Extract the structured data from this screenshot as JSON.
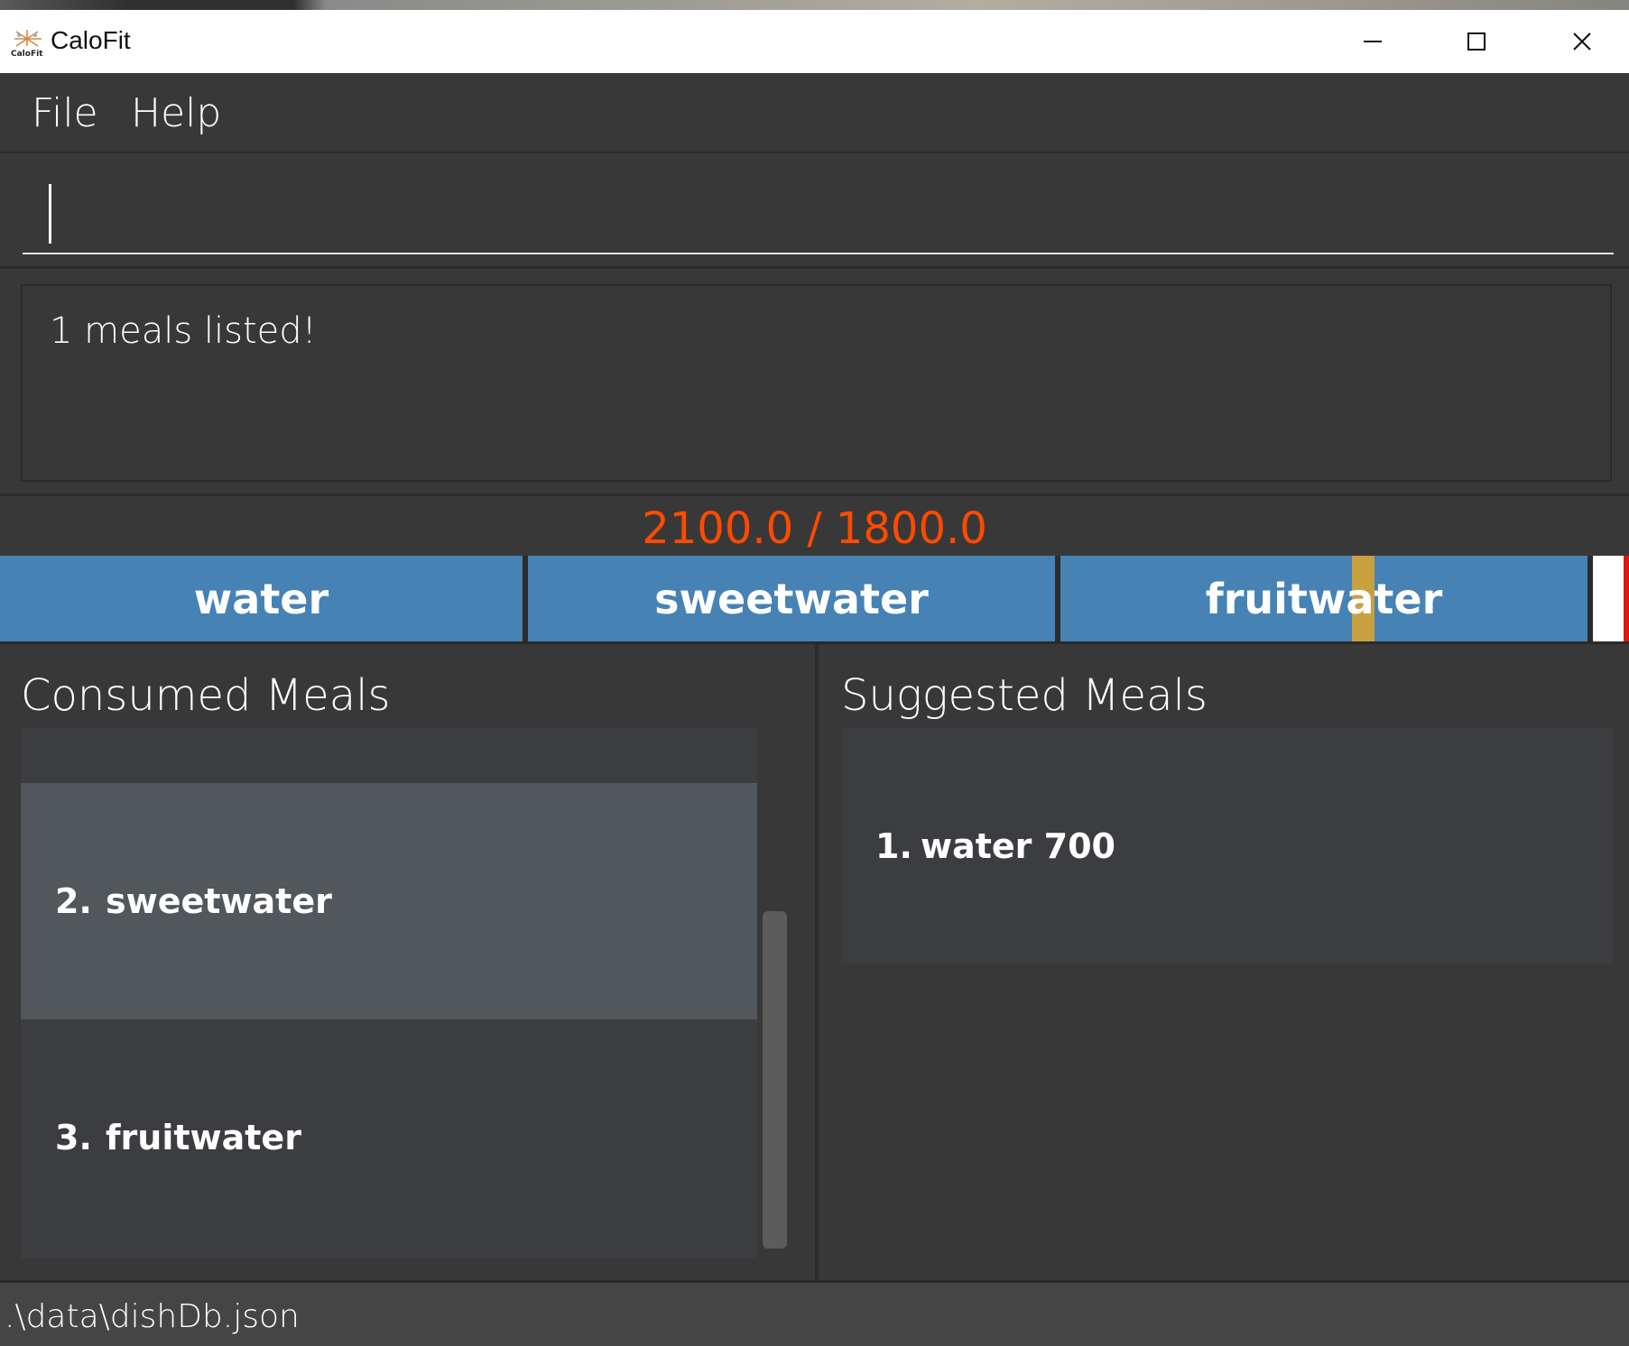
{
  "window": {
    "title": "CaloFit",
    "logo_text": "CaloFit"
  },
  "menu": {
    "items": [
      "File",
      "Help"
    ]
  },
  "command": {
    "value": ""
  },
  "result": {
    "message": "1 meals listed!"
  },
  "calories": {
    "text": "2100.0 / 1800.0",
    "color": "#ff4a00",
    "consumed": 2100.0,
    "budget": 1800.0
  },
  "meal_bar": {
    "blocks": [
      "water",
      "sweetwater",
      "fruitwater"
    ],
    "block_color": "#4682b4",
    "marker_color": "#c9a040",
    "overflow_color": "#e01515"
  },
  "consumed": {
    "title": "Consumed Meals",
    "items": [
      {
        "index": "2.",
        "name": "sweetwater"
      },
      {
        "index": "3.",
        "name": "fruitwater"
      }
    ]
  },
  "suggested": {
    "title": "Suggested Meals",
    "items": [
      {
        "index": "1.",
        "name": "water 700"
      }
    ]
  },
  "status": {
    "path": ".\\data\\dishDb.json"
  }
}
